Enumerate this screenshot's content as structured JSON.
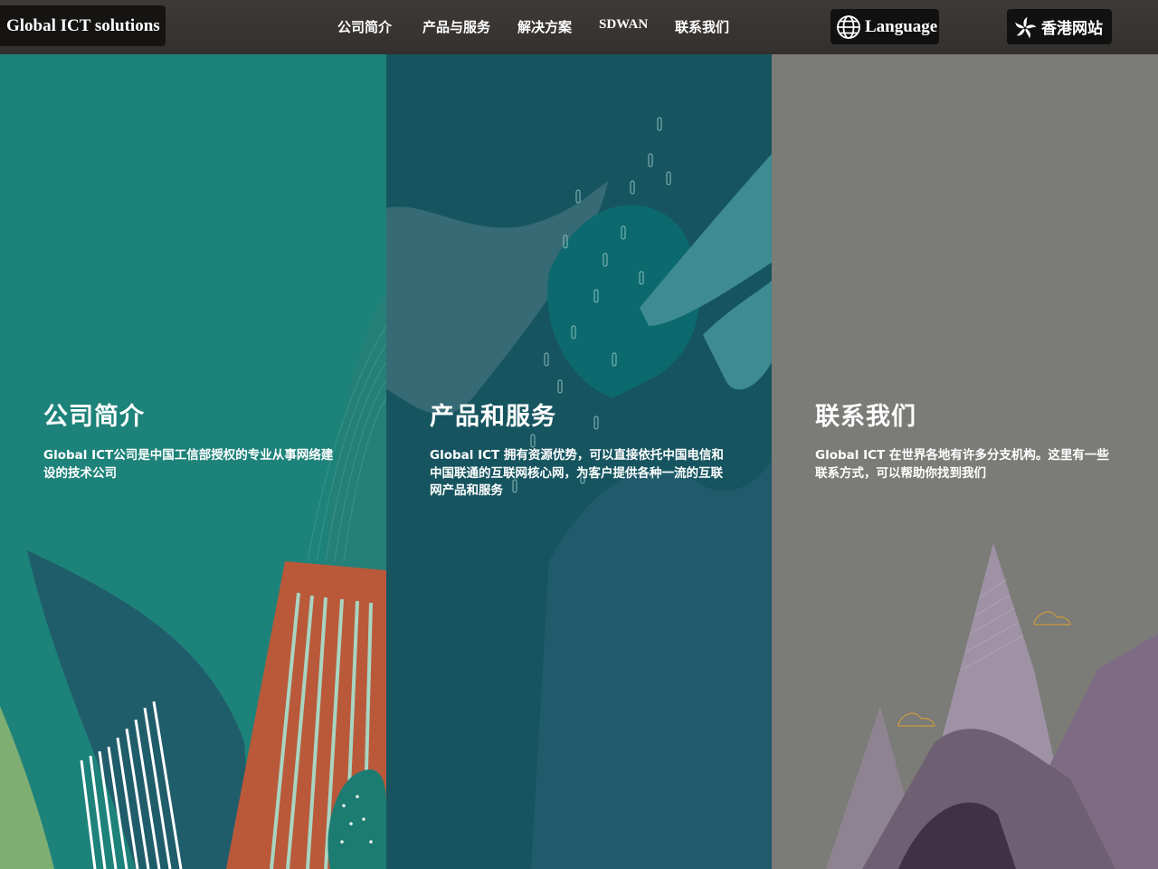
{
  "header": {
    "brand": "Global ICT solutions",
    "nav": [
      "公司简介",
      "产品与服务",
      "解决方案",
      "SDWAN",
      "联系我们"
    ],
    "language_label": "Language",
    "hk_site_label": "香港网站",
    "icons": {
      "language": "globe-icon",
      "hk_site": "bauhinia-flower-icon"
    }
  },
  "panels": [
    {
      "title": "公司简介",
      "description": "Global ICT公司是中国工信部授权的专业从事网络建设的技术公司",
      "color": "#1d8279"
    },
    {
      "title": "产品和服务",
      "description": "Global ICT 拥有资源优势，可以直接依托中国电信和中国联通的互联网核心网，为客户提供各种一流的互联网产品和服务",
      "color": "#165560"
    },
    {
      "title": "联系我们",
      "description": "Global ICT 在世界各地有许多分支机构。这里有一些联系方式，可以帮助你找到我们",
      "color": "#7b7b78"
    }
  ]
}
